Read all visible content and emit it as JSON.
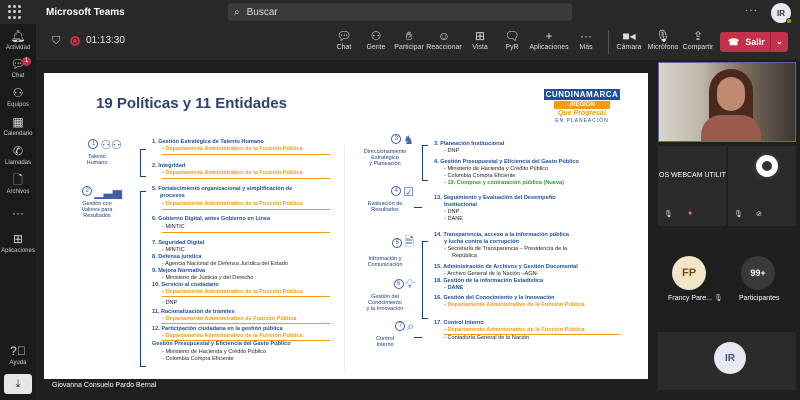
{
  "app": {
    "title": "Microsoft Teams",
    "search_placeholder": "Buscar",
    "more": "···",
    "avatar": "IR"
  },
  "rail": [
    {
      "label": "Actividad",
      "icon": "bell-icon"
    },
    {
      "label": "Chat",
      "icon": "chat-icon",
      "badge": "1"
    },
    {
      "label": "Equipos",
      "icon": "teams-icon"
    },
    {
      "label": "Calendario",
      "icon": "calendar-icon"
    },
    {
      "label": "Llamadas",
      "icon": "phone-icon"
    },
    {
      "label": "Archivos",
      "icon": "file-icon"
    },
    {
      "label": "···",
      "icon": "more-icon"
    },
    {
      "label": "Aplicaciones",
      "icon": "apps-icon"
    },
    {
      "label": "Ayuda",
      "icon": "help-icon"
    }
  ],
  "meeting": {
    "timer": "01:13:30",
    "controls": [
      {
        "label": "Chat",
        "icon": "chat-icon"
      },
      {
        "label": "Gente",
        "icon": "people-icon"
      },
      {
        "label": "Participar",
        "icon": "raise-hand-icon"
      },
      {
        "label": "Reaccionar",
        "icon": "react-icon"
      },
      {
        "label": "Vista",
        "icon": "view-icon"
      },
      {
        "label": "PyR",
        "icon": "qa-icon"
      },
      {
        "label": "Aplicaciones",
        "icon": "apps-icon"
      },
      {
        "label": "Más",
        "icon": "more-icon"
      },
      {
        "label": "Cámara",
        "icon": "camera-icon"
      },
      {
        "label": "Micrófono",
        "icon": "mic-icon"
      },
      {
        "label": "Compartir",
        "icon": "share-icon"
      }
    ],
    "leave_label": "Salir"
  },
  "slide": {
    "title": "19 Políticas  y 11 Entidades",
    "logo": {
      "line1": "CUNDINAMARCA",
      "line2": "¡REGIÓN",
      "line3": "Que Progresa!",
      "line4": "EN PLANEACIÓN"
    },
    "categories": [
      {
        "num": "1",
        "label": "Talento\nHumano",
        "icon": "people-icon"
      },
      {
        "num": "2",
        "label": "Gestión con\nValores para\nResultados",
        "icon": "bar-chart-icon"
      },
      {
        "num": "3",
        "label": "Direccionamiento\nEstratégico\ny Planeación",
        "icon": "chess-icon"
      },
      {
        "num": "4",
        "label": "Evaluación de\nResultados",
        "icon": "checklist-icon"
      },
      {
        "num": "5",
        "label": "Información y\nComunicación",
        "icon": "document-icon"
      },
      {
        "num": "6",
        "label": "Gestión del\nConocimiento\ny la Innovación",
        "icon": "lightbulb-icon"
      },
      {
        "num": "7",
        "label": "Control\nInterno",
        "icon": "magnifier-icon"
      }
    ],
    "left": {
      "p1": "1. Gestión Estratégica de Talento Humano",
      "p1o": "Departamento Administrativo de la Función Pública",
      "p2": "2. Integridad",
      "p2o": "Departamento Administrativo de la Función Pública",
      "p5": "5. Fortalecimiento organizacional  y simplificación de",
      "p5b": "procesos",
      "p5o": "Departamento Administrativo de la Función Pública",
      "p6": "6. Gobierno Digital, antes Gobierno en Línea",
      "p6k": "MINTIC",
      "p7": "7. Seguridad Digital",
      "p7k": "MINTIC",
      "p8": "8. Defensa jurídica",
      "p8k": "Agencia Nacional de Defensa Jurídica del Estado",
      "p9": "9. Mejora Normativa",
      "p9k": "Ministerio de Justicia y del Derecho",
      "p10": "10. Servicio al ciudadano",
      "p10o": "Departamento Administrativo de la Función Pública",
      "p10k": "DNP",
      "p11": "11. Racionalización de trámites",
      "p11o": "Departamento Administrativo de Función Pública",
      "p12": "12. Participación ciudadana en la gestión pública",
      "p12o": "Departamento Administrativo de la Función Pública",
      "p13x": "Gestión Presupuestal y Eficiencia del Gasto Público",
      "p13xk1": "Ministerio de Hacienda y Crédito Público",
      "p13xk2": "Colombia Compra Eficiente"
    },
    "right": {
      "p3": "3. Planeación Institucional",
      "p3k": "DNP",
      "p4": "4. Gestión Presupuestal y Eficiencia del Gasto Público",
      "p4k1": "Ministerio de Hacienda y Crédito Público",
      "p4k2": "Colombia Compra Eficiente",
      "p19": "19. Compras y contratación pública (Nueva)",
      "p13": "13. Seguimiento y Evaluación del Desempeño",
      "p13b": "Institucional",
      "p13k1": "DNP",
      "p13k2": "DANE",
      "p14": "14. Transparencia, acceso a la información pública",
      "p14b": "y lucha contra la corrupción",
      "p14k1": "Secretaría de Transparencia – Presidencia de la",
      "p14k2": "República",
      "p15": "15. Administración de Archivos y Gestión Documental",
      "p15k": "Archivo General de la Nación –AGN-",
      "p18": "18. Gestión  de la información Estadística",
      "p18k": "DANE",
      "p16": "16. Gestión del Conocimiento y la Innovación",
      "p16o": "Departamento Administrativo de la Función Pública",
      "p17": "17. Control Interno",
      "p17o": "Departamento Administrativo de la Función Pública",
      "p17k": "Contaduría General de la Nación"
    },
    "dash": "-"
  },
  "presenter": "Giovanna Consuelo Pardo Bernal",
  "participants": {
    "obs_label": "OS WEBCAM UTILIT",
    "fp_initials": "FP",
    "fp_name": "Francy Pare...",
    "more_count": "99+",
    "more_label": "Participantes",
    "self_initials": "IR"
  }
}
